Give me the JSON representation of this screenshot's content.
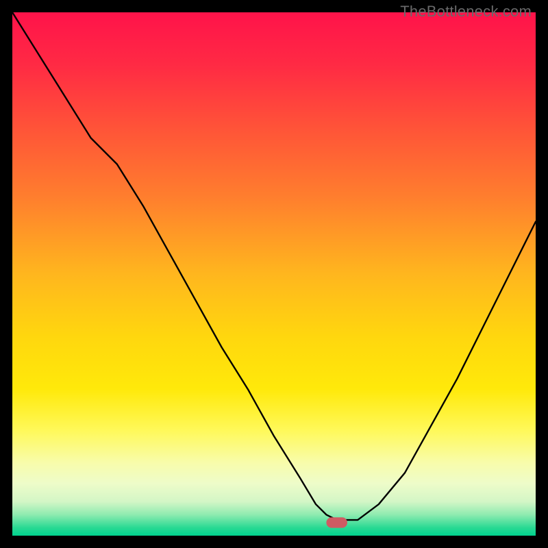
{
  "watermark": "TheBottleneck.com",
  "chart_data": {
    "type": "line",
    "title": "",
    "xlabel": "",
    "ylabel": "",
    "xlim": [
      0,
      100
    ],
    "ylim": [
      0,
      100
    ],
    "series": [
      {
        "name": "curve",
        "x": [
          0,
          5,
          10,
          15,
          20,
          25,
          30,
          35,
          40,
          45,
          50,
          55,
          58,
          60,
          62,
          64,
          66,
          70,
          75,
          80,
          85,
          90,
          95,
          100
        ],
        "values": [
          100,
          92,
          84,
          76,
          71,
          63,
          54,
          45,
          36,
          28,
          19,
          11,
          6,
          4,
          3,
          3,
          3,
          6,
          12,
          21,
          30,
          40,
          50,
          60
        ]
      }
    ],
    "marker": {
      "x": 62,
      "y": 2.5,
      "width": 4,
      "height": 2
    },
    "gradient_stops": [
      {
        "offset": 0.0,
        "color": "#ff134a"
      },
      {
        "offset": 0.1,
        "color": "#ff2a44"
      },
      {
        "offset": 0.22,
        "color": "#ff5338"
      },
      {
        "offset": 0.35,
        "color": "#ff7d2e"
      },
      {
        "offset": 0.5,
        "color": "#ffb61e"
      },
      {
        "offset": 0.62,
        "color": "#ffd70e"
      },
      {
        "offset": 0.72,
        "color": "#ffe90a"
      },
      {
        "offset": 0.8,
        "color": "#fff95b"
      },
      {
        "offset": 0.86,
        "color": "#f8fcaa"
      },
      {
        "offset": 0.9,
        "color": "#eefcc9"
      },
      {
        "offset": 0.935,
        "color": "#d3f6c6"
      },
      {
        "offset": 0.96,
        "color": "#8eebb0"
      },
      {
        "offset": 0.985,
        "color": "#28d993"
      },
      {
        "offset": 1.0,
        "color": "#00d28e"
      }
    ]
  }
}
